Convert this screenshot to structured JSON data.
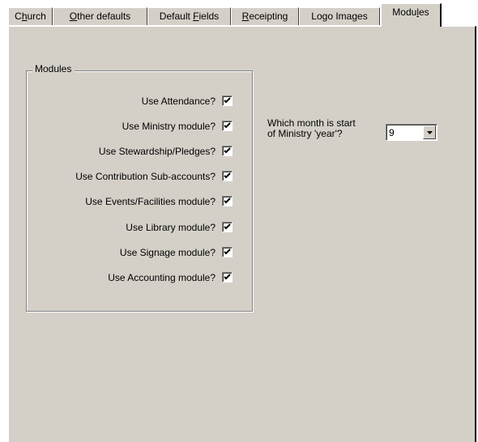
{
  "tabs": [
    {
      "label": "Church",
      "mnemonic": "h",
      "active": false
    },
    {
      "label": "Other defaults",
      "mnemonic": "O",
      "active": false
    },
    {
      "label": "Default Fields",
      "mnemonic": "F",
      "active": false
    },
    {
      "label": "Receipting",
      "mnemonic": "R",
      "active": false
    },
    {
      "label": "Logo Images",
      "mnemonic": "g",
      "active": false
    },
    {
      "label": "Modules",
      "mnemonic": "l",
      "active": true
    }
  ],
  "modules_group": {
    "title": "Modules",
    "options": [
      {
        "label": "Use Attendance?",
        "checked": true
      },
      {
        "label": "Use Ministry module?",
        "checked": true
      },
      {
        "label": "Use Stewardship/Pledges?",
        "checked": true
      },
      {
        "label": "Use Contribution Sub-accounts?",
        "checked": true
      },
      {
        "label": "Use Events/Facilities module?",
        "checked": true
      },
      {
        "label": "Use Library module?",
        "checked": true
      },
      {
        "label": "Use Signage module?",
        "checked": true
      },
      {
        "label": "Use Accounting module?",
        "checked": true
      }
    ]
  },
  "ministry_year": {
    "question_line1": "Which month is start",
    "question_line2": "of Ministry 'year'?",
    "value": "9"
  }
}
